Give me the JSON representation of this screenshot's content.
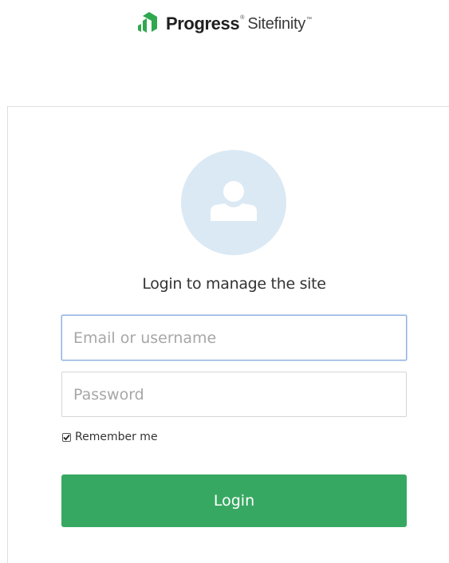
{
  "brand": {
    "company": "Progress",
    "product": "Sitefinity",
    "trademark": "™",
    "mark_color": "#2fa84f"
  },
  "login_card": {
    "avatar_icon": "user-icon",
    "avatar_bg": "#dbe9f4",
    "heading": "Login to manage the site",
    "email_field": {
      "placeholder": "Email or username",
      "value": ""
    },
    "password_field": {
      "placeholder": "Password",
      "value": ""
    },
    "remember_me": {
      "label": "Remember me",
      "checked": true
    },
    "login_button": {
      "label": "Login",
      "color": "#37a862"
    }
  }
}
